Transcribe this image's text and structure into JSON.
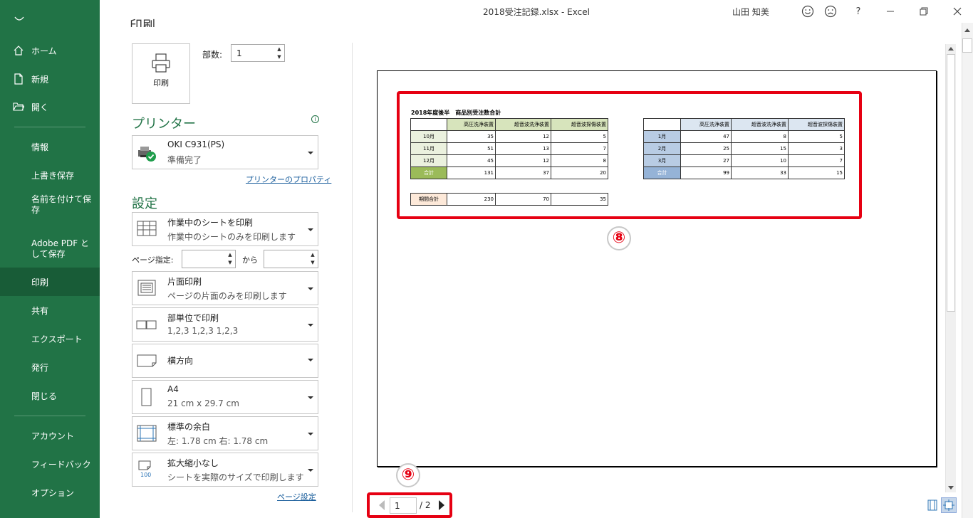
{
  "window": {
    "title": "2018受注記録.xlsx  -  Excel",
    "user": "山田 知美",
    "help": "?"
  },
  "sidebar": {
    "items": [
      {
        "label": "ホーム"
      },
      {
        "label": "新規"
      },
      {
        "label": "開く"
      },
      {
        "label": "情報"
      },
      {
        "label": "上書き保存"
      },
      {
        "label": "名前を付けて保存"
      },
      {
        "label": "Adobe PDF として保存"
      },
      {
        "label": "印刷"
      },
      {
        "label": "共有"
      },
      {
        "label": "エクスポート"
      },
      {
        "label": "発行"
      },
      {
        "label": "閉じる"
      },
      {
        "label": "アカウント"
      },
      {
        "label": "フィードバック"
      },
      {
        "label": "オプション"
      }
    ]
  },
  "print": {
    "heading": "印刷",
    "button_label": "印刷",
    "copies_label": "部数:",
    "copies_value": "1"
  },
  "printer": {
    "heading": "プリンター",
    "name": "OKI C931(PS)",
    "status": "準備完了",
    "properties_link": "プリンターのプロパティ"
  },
  "settings": {
    "heading": "設定",
    "scope": {
      "title": "作業中のシートを印刷",
      "desc": "作業中のシートのみを印刷します"
    },
    "pages_label": "ページ指定:",
    "pages_from": "",
    "pages_to_label": "から",
    "pages_to": "",
    "sides": {
      "title": "片面印刷",
      "desc": "ページの片面のみを印刷します"
    },
    "collate": {
      "title": "部単位で印刷",
      "desc": "1,2,3    1,2,3    1,2,3"
    },
    "orientation": {
      "title": "横方向"
    },
    "paper": {
      "title": "A4",
      "desc": "21 cm x 29.7 cm"
    },
    "margins": {
      "title": "標準の余白",
      "desc": "左:  1.78 cm    右:  1.78 cm"
    },
    "scaling": {
      "title": "拡大縮小なし",
      "desc": "シートを実際のサイズで印刷します",
      "icon_text": "100"
    },
    "page_setup_link": "ページ設定"
  },
  "preview": {
    "sheet_title": "2018年度後半　商品別受注数合計",
    "headers": [
      "高圧洗浄装置",
      "超音波洗浄装置",
      "超音波探傷装置"
    ],
    "table1": {
      "rows": [
        {
          "label": "10月",
          "values": [
            "35",
            "12",
            "5"
          ]
        },
        {
          "label": "11月",
          "values": [
            "51",
            "13",
            "7"
          ]
        },
        {
          "label": "12月",
          "values": [
            "45",
            "12",
            "8"
          ]
        },
        {
          "label": "合計",
          "values": [
            "131",
            "37",
            "20"
          ]
        }
      ]
    },
    "table2": {
      "rows": [
        {
          "label": "1月",
          "values": [
            "47",
            "8",
            "5"
          ]
        },
        {
          "label": "2月",
          "values": [
            "25",
            "15",
            "3"
          ]
        },
        {
          "label": "3月",
          "values": [
            "27",
            "10",
            "7"
          ]
        },
        {
          "label": "合計",
          "values": [
            "99",
            "33",
            "15"
          ]
        }
      ]
    },
    "period_total": {
      "label": "期間合計",
      "values": [
        "230",
        "70",
        "35"
      ]
    },
    "colors": {
      "green_header": "#d7e4bc",
      "green_label": "#ebf1de",
      "green_total": "#9bbb59",
      "blue_header": "#dce6f1",
      "blue_label": "#b8cce4",
      "blue_total": "#95b3d7",
      "peach": "#fde9d9"
    }
  },
  "annotations": {
    "marker8": "⑧",
    "marker9": "⑨",
    "highlight_color": "#e60012"
  },
  "page_nav": {
    "current": "1",
    "total": "/ 2"
  }
}
